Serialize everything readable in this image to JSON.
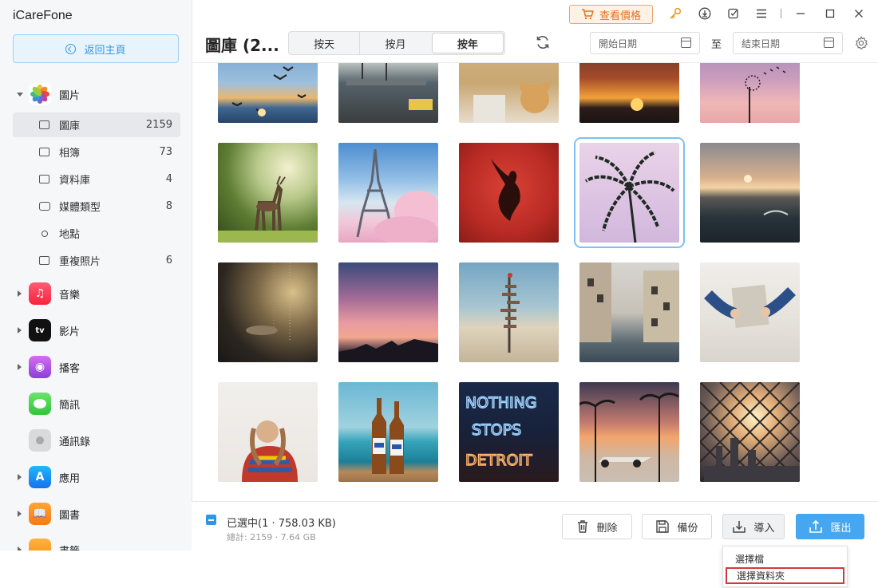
{
  "app": {
    "brand": "iCareFone"
  },
  "sidebar": {
    "home_label": "返回主頁",
    "categories": [
      {
        "label": "圖片",
        "expanded": true,
        "icon": "photos-icon"
      },
      {
        "label": "音樂",
        "icon": "music-icon"
      },
      {
        "label": "影片",
        "icon": "apple-tv-icon"
      },
      {
        "label": "播客",
        "icon": "podcast-icon"
      },
      {
        "label": "簡訊",
        "icon": "messages-icon"
      },
      {
        "label": "通訊錄",
        "icon": "contacts-icon"
      },
      {
        "label": "應用",
        "icon": "app-store-icon"
      },
      {
        "label": "圖書",
        "icon": "books-icon"
      },
      {
        "label": "書籤",
        "icon": "bookmarks-icon"
      }
    ],
    "photo_items": [
      {
        "label": "圖庫",
        "count": "2159",
        "active": true,
        "icon": "library-icon"
      },
      {
        "label": "相簿",
        "count": "73",
        "icon": "album-icon"
      },
      {
        "label": "資料庫",
        "count": "4",
        "icon": "database-icon"
      },
      {
        "label": "媒體類型",
        "count": "8",
        "icon": "media-type-icon"
      },
      {
        "label": "地點",
        "count": "",
        "icon": "location-icon"
      },
      {
        "label": "重複照片",
        "count": "6",
        "icon": "duplicate-icon"
      }
    ]
  },
  "header": {
    "title": "圖庫 (2...",
    "view_tabs": [
      "按天",
      "按月",
      "按年"
    ],
    "active_tab": "按年",
    "start_date_placeholder": "開始日期",
    "end_date_placeholder": "結束日期",
    "to_label": "至",
    "price_button": "查看價格"
  },
  "grid": {
    "selected_index": 8,
    "photos": [
      "seagulls-sunset",
      "street-palms",
      "teddy-bears",
      "orange-sunset",
      "dandelion-sky",
      "deer-forest",
      "eiffel-tower",
      "red-angel-statue",
      "palm-pink-sky",
      "lake-sunset",
      "dark-room-lights",
      "pink-sunset-silhouette",
      "signpost-desert",
      "venice-canal",
      "hands-newspaper",
      "woman-colorful-sweater",
      "beer-bottles-beach",
      "nothing-stops-detroit",
      "vintage-car-palms",
      "fence-city-sunset"
    ]
  },
  "footer": {
    "selected_text": "已選中(1 · 758.03 KB)",
    "total_text": "總計: 2159 · 7.64 GB",
    "delete_label": "刪除",
    "backup_label": "備份",
    "import_label": "導入",
    "export_label": "匯出"
  },
  "import_menu": {
    "items": [
      "選擇檔",
      "選擇資料夾"
    ],
    "highlighted": 1
  },
  "colors": {
    "accent": "#46a6ef",
    "price": "#e5711e",
    "highlight": "#d23a3a"
  }
}
